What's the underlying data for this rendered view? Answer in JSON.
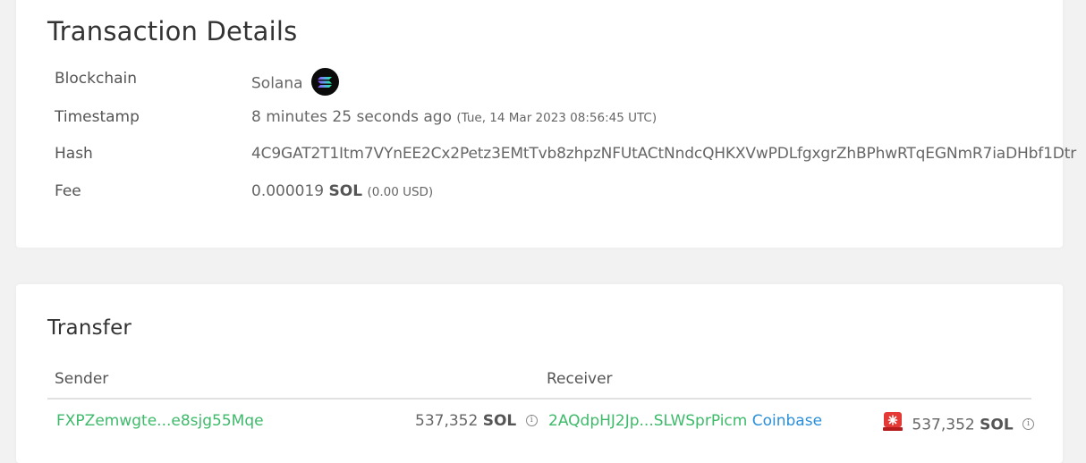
{
  "details": {
    "title": "Transaction Details",
    "blockchain": {
      "label": "Blockchain",
      "value": "Solana",
      "icon": "solana-logo-icon"
    },
    "timestamp": {
      "label": "Timestamp",
      "relative": "8 minutes 25 seconds ago",
      "absolute": "(Tue, 14 Mar 2023 08:56:45 UTC)"
    },
    "hash": {
      "label": "Hash",
      "value": "4C9GAT2T1Itm7VYnEE2Cx2Petz3EMtTvb8zhpzNFUtACtNndcQHKXVwPDLfgxgrZhBPhwRTqEGNmR7iaDHbf1Dtr"
    },
    "fee": {
      "label": "Fee",
      "amount": "0.000019",
      "unit": "SOL",
      "usd": "(0.00 USD)"
    }
  },
  "transfer": {
    "title": "Transfer",
    "columns": {
      "sender": "Sender",
      "receiver": "Receiver"
    },
    "rows": [
      {
        "sender_address": "FXPZemwgte...e8sjg55Mqe",
        "sender_amount": "537,352",
        "sender_unit": "SOL",
        "receiver_address": "2AQdpHJ2Jp...SLWSprPicm",
        "receiver_tag": "Coinbase",
        "receiver_amount": "537,352",
        "receiver_unit": "SOL"
      }
    ]
  },
  "colors": {
    "link_green": "#3dba6a",
    "link_blue": "#2a8fd8",
    "alert_red": "#e53935"
  }
}
